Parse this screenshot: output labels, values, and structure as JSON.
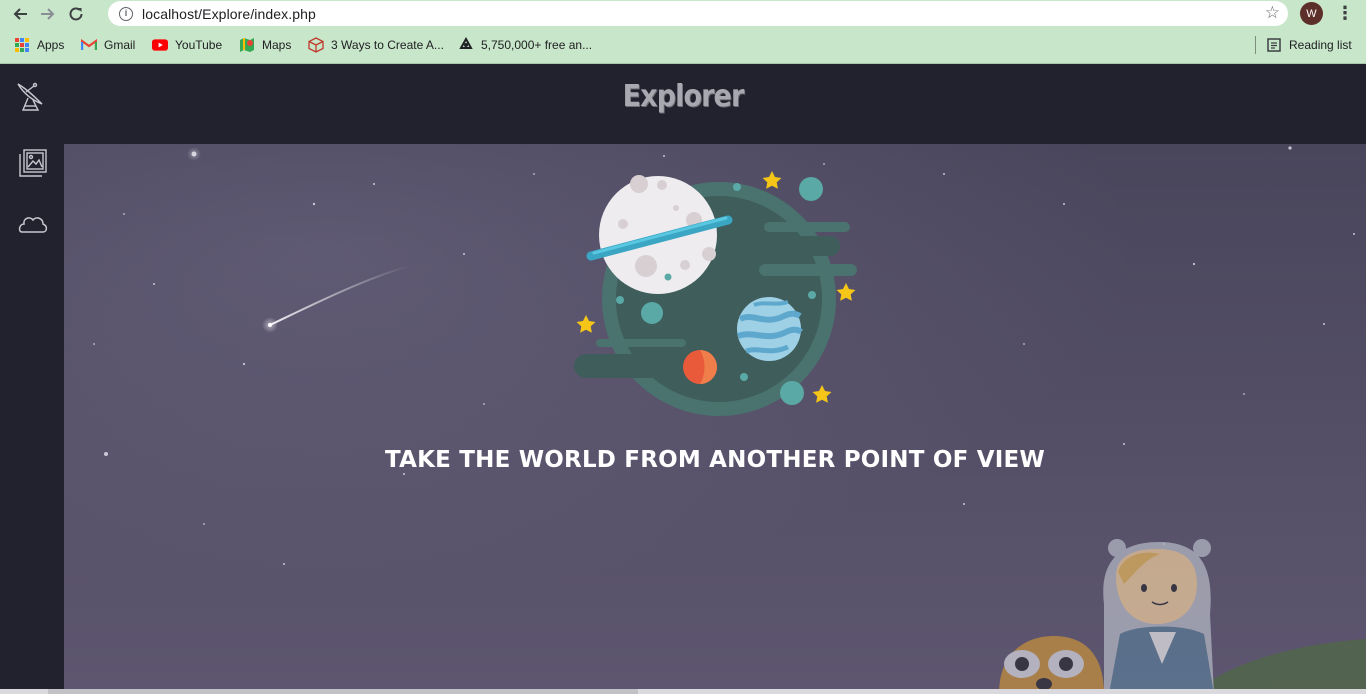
{
  "browser": {
    "url": "localhost/Explore/index.php",
    "profile_initial": "W",
    "bookmarks": [
      {
        "label": "Apps",
        "icon": "apps-grid-icon"
      },
      {
        "label": "Gmail",
        "icon": "gmail-icon"
      },
      {
        "label": "YouTube",
        "icon": "youtube-icon"
      },
      {
        "label": "Maps",
        "icon": "maps-icon"
      },
      {
        "label": "3 Ways to Create A...",
        "icon": "cube-icon"
      },
      {
        "label": "5,750,000+ free an...",
        "icon": "recycle-icon"
      }
    ],
    "reading_list": "Reading list"
  },
  "site": {
    "title": "Explorer",
    "sidebar_icons": [
      "satellite-dish-icon",
      "gallery-icon",
      "cloud-icon"
    ],
    "tagline": "TAKE THE WORLD FROM ANOTHER POINT OF VIEW"
  },
  "colors": {
    "chrome_green": "#c8e6c9",
    "page_dark": "#22222e",
    "hero_purple": "#524d64",
    "planet_teal": "#4a726e",
    "star_yellow": "#f5c518"
  }
}
